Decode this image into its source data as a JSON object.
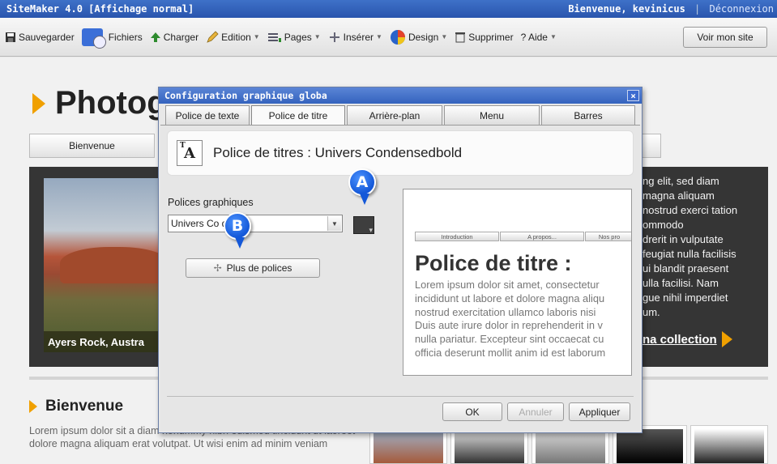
{
  "titlebar": {
    "app_title": "SiteMaker 4.0  [Affichage normal]",
    "welcome": "Bienvenue, kevinicus",
    "separator": "|",
    "logout": "Déconnexion"
  },
  "toolbar": {
    "items": [
      {
        "label": "Sauvegarder",
        "icon": "floppy-disk-icon"
      },
      {
        "label": "Fichiers",
        "icon": "files-cd-icon"
      },
      {
        "label": "Charger",
        "icon": "upload-arrow-icon"
      },
      {
        "label": "Edition",
        "icon": "pencil-icon"
      },
      {
        "label": "Pages",
        "icon": "pages-icon"
      },
      {
        "label": "Insérer",
        "icon": "insert-plus-icon"
      },
      {
        "label": "Design",
        "icon": "palette-globe-icon"
      },
      {
        "label": "Supprimer",
        "icon": "trash-icon"
      },
      {
        "label": "? Aide",
        "icon": "help-icon"
      }
    ],
    "view_site": "Voir mon site"
  },
  "page": {
    "title": "Photogr",
    "tabs": [
      "Bienvenue"
    ],
    "photo_caption": "Ayers Rock, Austra",
    "banner_lines": [
      "ng elit, sed diam",
      " magna aliquam",
      "nostrud exerci tation",
      "ommodo",
      "drerit in vulputate",
      "feugiat nulla facilisis",
      "ui blandit praesent",
      "ulla facilisi. Nam",
      "gue nihil imperdiet",
      "um."
    ],
    "banner_link": "na collection",
    "section_title": "Bienvenue",
    "section_text": "Lorem ipsum dolor sit a                                   diam nonummy nibh euismod tincidunt ut laoreet dolore magna aliquam erat volutpat. Ut wisi enim ad minim veniam"
  },
  "dialog": {
    "title": "Configuration graphique globa",
    "close": "×",
    "tabs": [
      "Police de texte",
      "Police de titre",
      "Arrière-plan",
      "Menu",
      "Barres"
    ],
    "active_tab": "Police de titre",
    "header_icon_text": "A",
    "header_icon_small": "T",
    "header_text": "Police de titres : Univers Condensedbold",
    "fonts_label": "Polices graphiques",
    "font_value": "Univers Co        dbold",
    "color_value": "#3e3e3e",
    "more_fonts": "Plus de polices",
    "preview": {
      "tabs": [
        "Introduction",
        "A propos...",
        "Nos pro"
      ],
      "title": "Police de titre :",
      "lines": [
        "Lorem ipsum dolor sit amet, consectetur",
        "incididunt ut labore et dolore magna aliqu",
        "nostrud exercitation ullamco laboris nisi",
        "Duis aute irure dolor in reprehenderit in v",
        "nulla pariatur. Excepteur sint occaecat cu",
        "officia deserunt mollit anim id est laborum"
      ]
    },
    "buttons": {
      "ok": "OK",
      "cancel": "Annuler",
      "apply": "Appliquer"
    }
  },
  "callouts": {
    "a": "A",
    "b": "B"
  }
}
